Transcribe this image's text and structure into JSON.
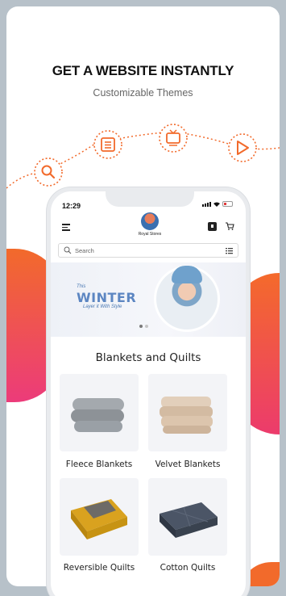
{
  "hero": {
    "headline": "GET A WEBSITE INSTANTLY",
    "subheadline": "Customizable Themes",
    "flow_icons": [
      "search-icon",
      "list-icon",
      "tv-icon",
      "play-icon"
    ],
    "accent_color": "#f26a2b",
    "blob_gradient": [
      "#f26a2b",
      "#ec3b7a"
    ]
  },
  "phone": {
    "status_time": "12:29",
    "store_name": "Royal Stores",
    "search_placeholder": "Search",
    "banner": {
      "line1": "This",
      "title": "WINTER",
      "tagline": "Layer it With Style"
    },
    "section_title": "Blankets and Quilts",
    "products": [
      {
        "label": "Fleece Blankets",
        "color": "#9aa0a6"
      },
      {
        "label": "Velvet Blankets",
        "color": "#d8c2ab"
      },
      {
        "label": "Reversible Quilts",
        "color": "#d9a21f"
      },
      {
        "label": "Cotton Quilts",
        "color": "#3c4657"
      }
    ]
  }
}
